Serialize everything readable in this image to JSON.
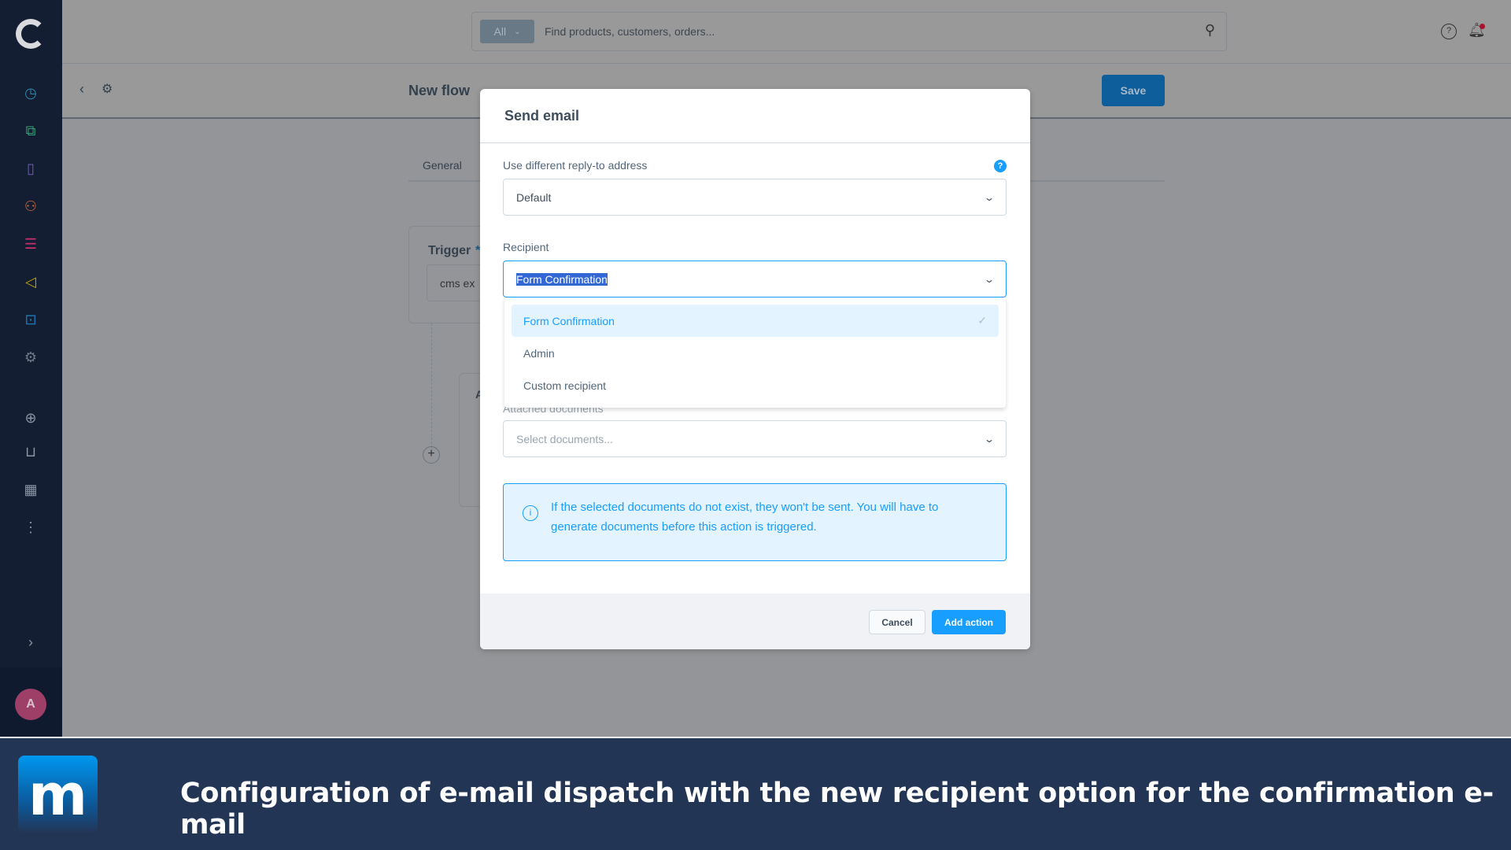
{
  "sidebar": {
    "logo": "shopware-logo",
    "items": [
      {
        "icon": "dashboard-icon",
        "color": "#2d8bb0"
      },
      {
        "icon": "catalogue-icon",
        "color": "#36a175"
      },
      {
        "icon": "orders-icon",
        "color": "#6b5bb8"
      },
      {
        "icon": "customers-icon",
        "color": "#d26a3a"
      },
      {
        "icon": "content-icon",
        "color": "#c8316c"
      },
      {
        "icon": "marketing-icon",
        "color": "#c2a400"
      },
      {
        "icon": "extensions-icon",
        "color": "#1e7ab8"
      },
      {
        "icon": "settings-icon",
        "color": "#6d7a88"
      }
    ],
    "avatar": "A"
  },
  "topbar": {
    "search_filter": "All",
    "search_placeholder": "Find products, customers, orders..."
  },
  "header": {
    "title": "New flow",
    "save": "Save"
  },
  "tabs": {
    "general": "General"
  },
  "flow": {
    "trigger_label": "Trigger",
    "trigger_required": "*",
    "trigger_value": "cms ex",
    "action_partial": "A"
  },
  "modal": {
    "title": "Send email",
    "reply_to_label": "Use different reply-to address",
    "reply_to_value": "Default",
    "recipient_label": "Recipient",
    "recipient_value": "Form Confirmation",
    "recipient_options": [
      "Form Confirmation",
      "Admin",
      "Custom recipient"
    ],
    "attached_label": "Attached documents",
    "attached_placeholder": "Select documents...",
    "info": "If the selected documents do not exist, they won't be sent. You will have to generate documents before this action is triggered.",
    "cancel": "Cancel",
    "add_action": "Add action"
  },
  "banner": {
    "logo": "m",
    "text": "Configuration of e-mail dispatch with the new recipient option for the confirmation e-mail"
  }
}
